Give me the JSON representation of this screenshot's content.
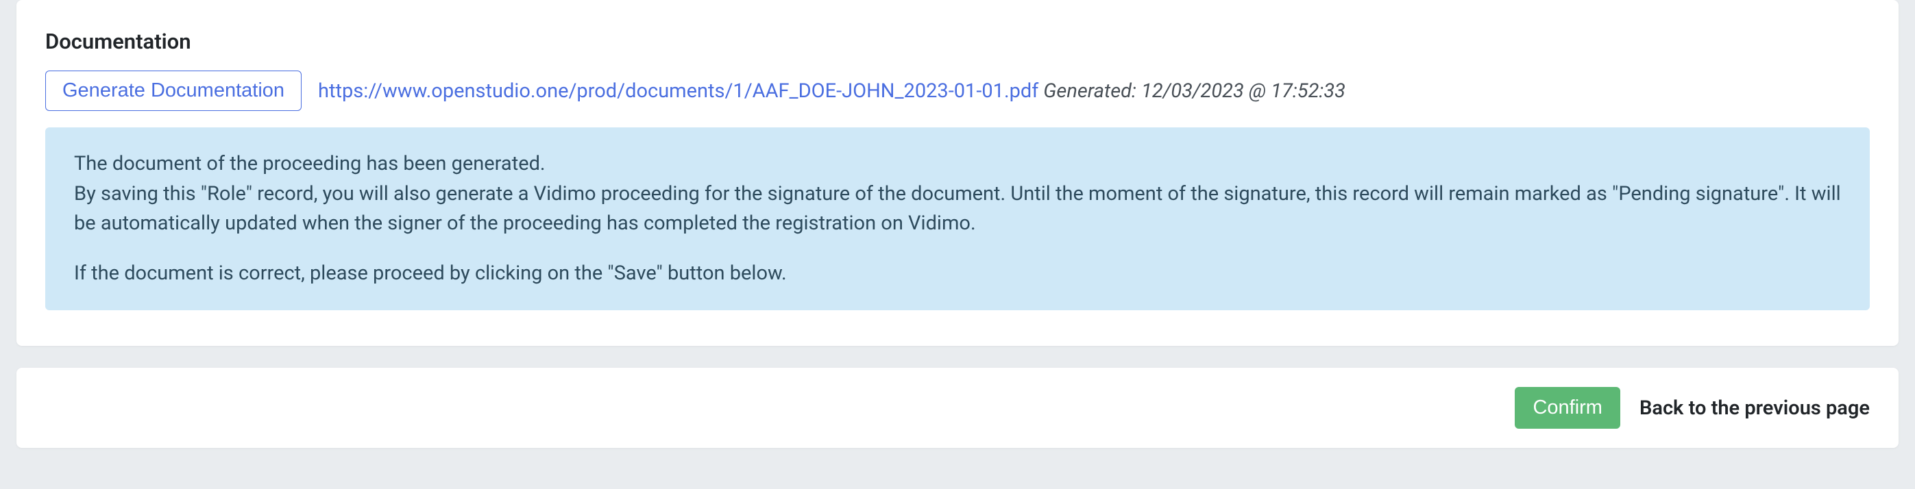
{
  "documentation": {
    "section_title": "Documentation",
    "generate_button": "Generate Documentation",
    "link_text": "https://www.openstudio.one/prod/documents/1/AAF_DOE-JOHN_2023-01-01.pdf",
    "generated_label": "Generated: 12/03/2023 @ 17:52:33",
    "alert_line1": "The document of the proceeding has been generated.",
    "alert_line2": "By saving this \"Role\" record, you will also generate a Vidimo proceeding for the signature of the document. Until the moment of the signature, this record will remain marked as \"Pending signature\". It will be automatically updated when the signer of the proceeding has completed the registration on Vidimo.",
    "alert_line3": "If the document is correct, please proceed by clicking on the \"Save\" button below."
  },
  "footer": {
    "confirm_label": "Confirm",
    "back_label": "Back to the previous page"
  }
}
